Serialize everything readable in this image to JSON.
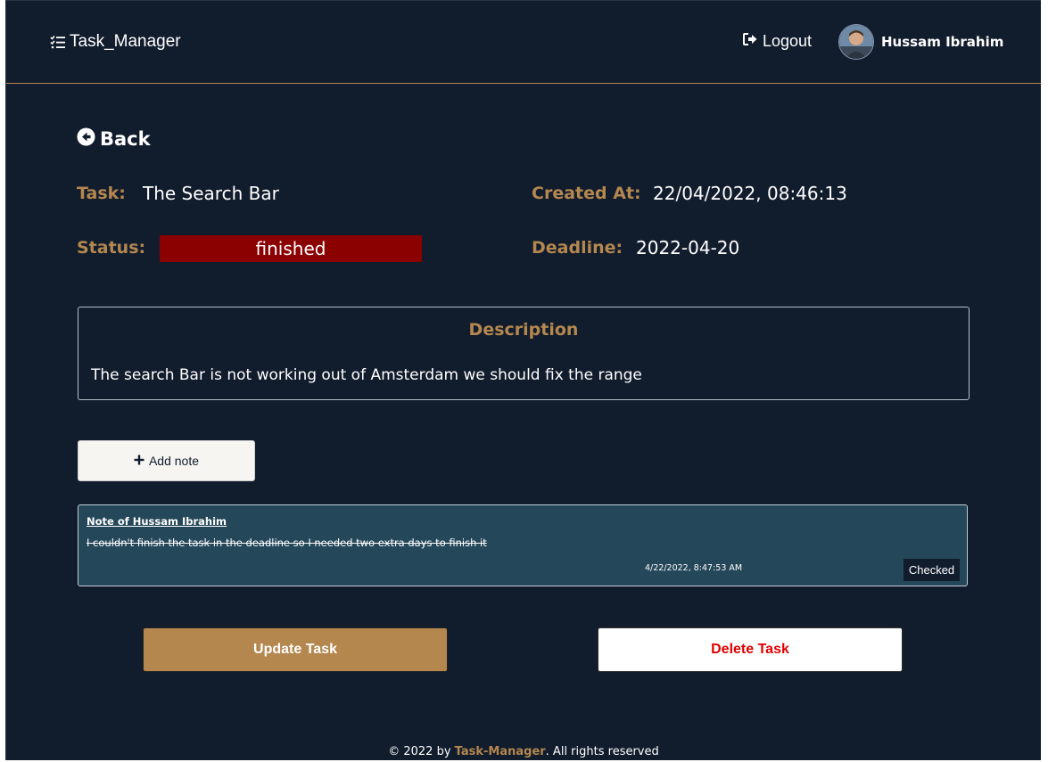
{
  "navbar": {
    "brand": "Task_Manager",
    "brand_icon": "checklist-icon",
    "logout_label": "Logout",
    "logout_icon": "sign-out-icon",
    "user_name": "Hussam Ibrahim"
  },
  "back": {
    "label": "Back",
    "icon": "arrow-circle-left-icon"
  },
  "task": {
    "task_label": "Task:",
    "task_value": "The Search Bar",
    "created_label": "Created At:",
    "created_value": "22/04/2022, 08:46:13",
    "status_label": "Status:",
    "status_value": "finished",
    "deadline_label": "Deadline:",
    "deadline_value": "2022-04-20"
  },
  "description": {
    "title": "Description",
    "text": "The search Bar is not working out of Amsterdam we should fix the range"
  },
  "add_note": {
    "label": "Add note",
    "icon": "plus-icon"
  },
  "notes": [
    {
      "title": "Note of Hussam Ibrahim",
      "text": "I couldn't finish the task in the deadline so I needed two extra days to finish it",
      "date": "4/22/2022, 8:47:53 AM",
      "badge": "Checked"
    }
  ],
  "actions": {
    "update_label": "Update Task",
    "delete_label": "Delete Task"
  },
  "footer": {
    "prefix": "© 2022 by ",
    "brand": "Task-Manager",
    "suffix": ". All rights reserved"
  },
  "colors": {
    "background": "#111c2d",
    "accent": "#b4874f",
    "status_finished": "#8b0000",
    "note_card": "#244759",
    "delete_text": "#e00000"
  }
}
